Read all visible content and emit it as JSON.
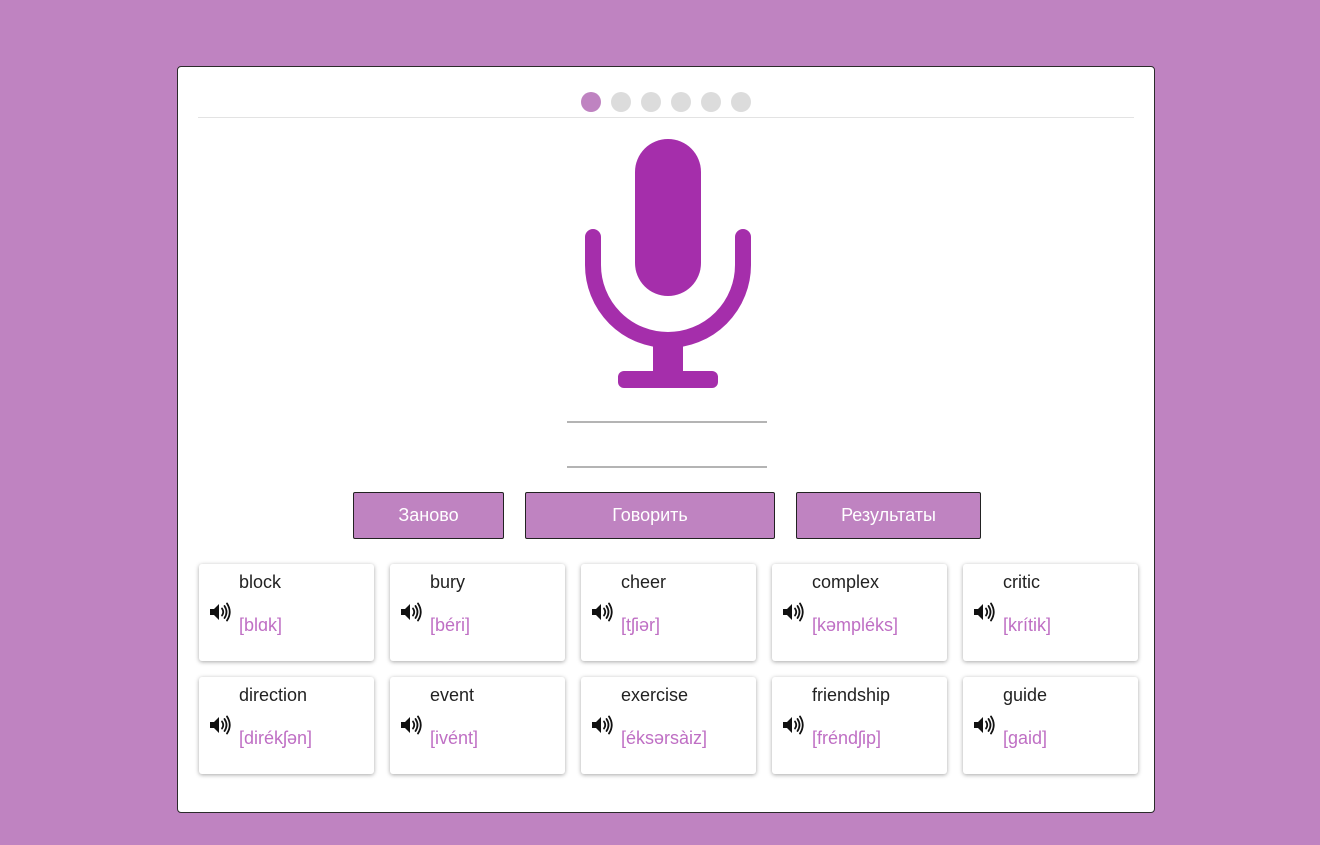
{
  "progress": {
    "total_steps": 6,
    "current_step": 1,
    "active_color": "#bf83c1",
    "inactive_color": "#dcdcdc"
  },
  "mic": {
    "icon": "microphone-icon",
    "color": "#a52eab"
  },
  "buttons": {
    "restart": "Заново",
    "speak": "Говорить",
    "results": "Результаты"
  },
  "words": [
    {
      "word": "block",
      "transcription": "[blɑk]"
    },
    {
      "word": "bury",
      "transcription": "[béri]"
    },
    {
      "word": "cheer",
      "transcription": "[tʃiər]"
    },
    {
      "word": "complex",
      "transcription": "[kəmpléks]"
    },
    {
      "word": "critic",
      "transcription": "[krítik]"
    },
    {
      "word": "direction",
      "transcription": "[dirékʃən]"
    },
    {
      "word": "event",
      "transcription": "[ivént]"
    },
    {
      "word": "exercise",
      "transcription": "[éksərsàiz]"
    },
    {
      "word": "friendship",
      "transcription": "[fréndʃip]"
    },
    {
      "word": "guide",
      "transcription": "[gaid]"
    }
  ],
  "colors": {
    "background": "#bf83c1",
    "accent": "#bf83c1",
    "transcription": "#bf6fc4"
  }
}
